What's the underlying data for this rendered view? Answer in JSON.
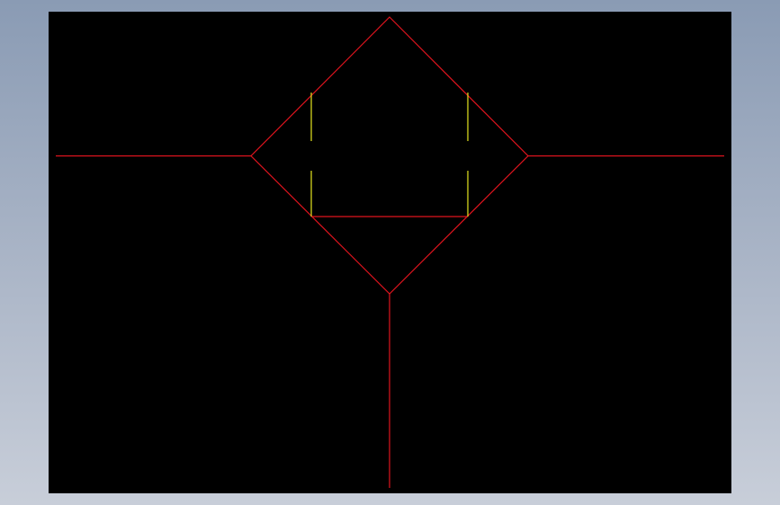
{
  "viewport": {
    "background": "#000000",
    "window_gradient": [
      "#8a9bb4",
      "#c8ced9"
    ]
  },
  "colors": {
    "primary_line": "#e0141e",
    "hidden_line": "#e6e61e"
  },
  "drawing": {
    "label": ""
  }
}
